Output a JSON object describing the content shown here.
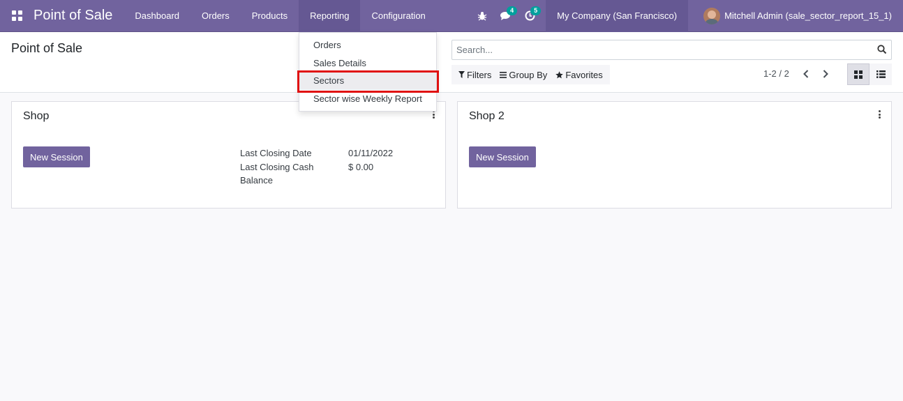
{
  "navbar": {
    "app_name": "Point of Sale",
    "menu": [
      {
        "label": "Dashboard"
      },
      {
        "label": "Orders"
      },
      {
        "label": "Products"
      },
      {
        "label": "Reporting"
      },
      {
        "label": "Configuration"
      }
    ],
    "messages_count": "4",
    "activities_count": "5",
    "company": "My Company (San Francisco)",
    "user": "Mitchell Admin (sale_sector_report_15_1)",
    "color": "#71639e"
  },
  "reporting_dropdown": {
    "items": [
      {
        "label": "Orders"
      },
      {
        "label": "Sales Details"
      },
      {
        "label": "Sectors"
      },
      {
        "label": "Sector wise Weekly Report"
      }
    ],
    "highlighted": "Sectors"
  },
  "control_panel": {
    "title": "Point of Sale",
    "search_placeholder": "Search...",
    "filters_label": "Filters",
    "group_by_label": "Group By",
    "favorites_label": "Favorites",
    "pager": "1-2 / 2"
  },
  "cards": [
    {
      "title": "Shop",
      "button": "New Session",
      "last_closing_date_label": "Last Closing Date",
      "last_closing_date": "01/11/2022",
      "last_closing_cash_label": "Last Closing Cash",
      "last_closing_cash_label_2": "Balance",
      "last_closing_cash": "$ 0.00"
    },
    {
      "title": "Shop 2",
      "button": "New Session"
    }
  ],
  "colors": {
    "primary": "#71639e",
    "highlight_border": "#e01010"
  }
}
